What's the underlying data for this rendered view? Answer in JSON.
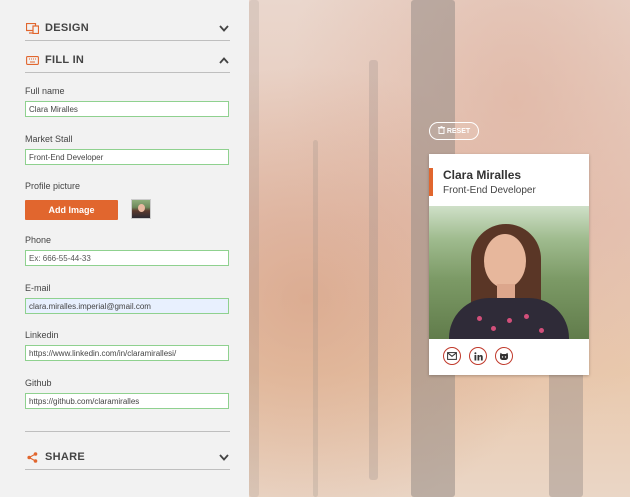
{
  "sections": {
    "design": {
      "title": "DESIGN",
      "icon": "monitor-icon"
    },
    "fill_in": {
      "title": "FILL IN",
      "icon": "keyboard-icon"
    },
    "share": {
      "title": "SHARE",
      "icon": "share-icon"
    }
  },
  "form": {
    "full_name": {
      "label": "Full name",
      "value": "Clara Miralles"
    },
    "market_stall": {
      "label": "Market Stall",
      "value": "Front-End Developer"
    },
    "profile_picture": {
      "label": "Profile picture",
      "button": "Add Image"
    },
    "phone": {
      "label": "Phone",
      "placeholder": "Ex: 666-55-44-33"
    },
    "email": {
      "label": "E-mail",
      "value": "clara.miralles.imperial@gmail.com"
    },
    "linkedin": {
      "label": "Linkedin",
      "value": "https://www.linkedin.com/in/claramirallesi/"
    },
    "github": {
      "label": "Github",
      "value": "https://github.com/claramiralles"
    }
  },
  "preview": {
    "reset_label": "RESET",
    "card_name": "Clara Miralles",
    "card_job": "Front-End Developer",
    "social_icons": [
      "mail-icon",
      "linkedin-icon",
      "github-icon"
    ]
  },
  "colors": {
    "accent": "#e1662e",
    "field_border": "#8fd18f",
    "social_border": "#c0392b"
  }
}
